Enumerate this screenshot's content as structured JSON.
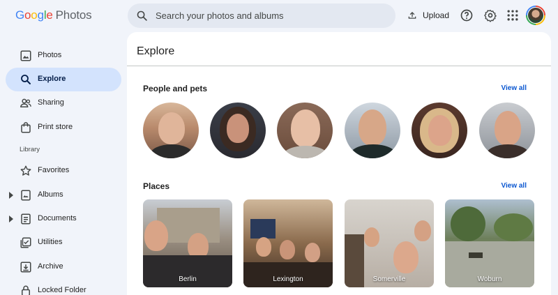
{
  "app": {
    "logo_letters": [
      "G",
      "o",
      "o",
      "g",
      "l",
      "e"
    ],
    "product": "Photos"
  },
  "header": {
    "search_placeholder": "Search your photos and albums",
    "upload_label": "Upload",
    "icons": [
      "search-icon",
      "upload-icon",
      "help-icon",
      "settings-icon",
      "apps-grid-icon",
      "account-avatar"
    ]
  },
  "sidebar": {
    "items": [
      {
        "label": "Photos",
        "icon": "photo-icon"
      },
      {
        "label": "Explore",
        "icon": "search-icon",
        "active": true
      },
      {
        "label": "Sharing",
        "icon": "people-icon"
      },
      {
        "label": "Print store",
        "icon": "bag-icon"
      }
    ],
    "library_label": "Library",
    "library_items": [
      {
        "label": "Favorites",
        "icon": "star-icon"
      },
      {
        "label": "Albums",
        "icon": "album-icon",
        "expandable": true
      },
      {
        "label": "Documents",
        "icon": "document-icon",
        "expandable": true
      },
      {
        "label": "Utilities",
        "icon": "utilities-icon"
      },
      {
        "label": "Archive",
        "icon": "archive-icon"
      },
      {
        "label": "Locked Folder",
        "icon": "lock-icon"
      }
    ]
  },
  "main": {
    "title": "Explore",
    "people_section": {
      "title": "People and pets",
      "view_all": "View all",
      "count": 6
    },
    "places_section": {
      "title": "Places",
      "view_all": "View all",
      "places": [
        "Berlin",
        "Lexington",
        "Somerville",
        "Woburn"
      ]
    }
  },
  "colors": {
    "accent": "#0b57d0",
    "active_nav_bg": "#d3e3fd",
    "page_bg": "#f1f4fa",
    "search_bg": "#e3e8f1"
  }
}
